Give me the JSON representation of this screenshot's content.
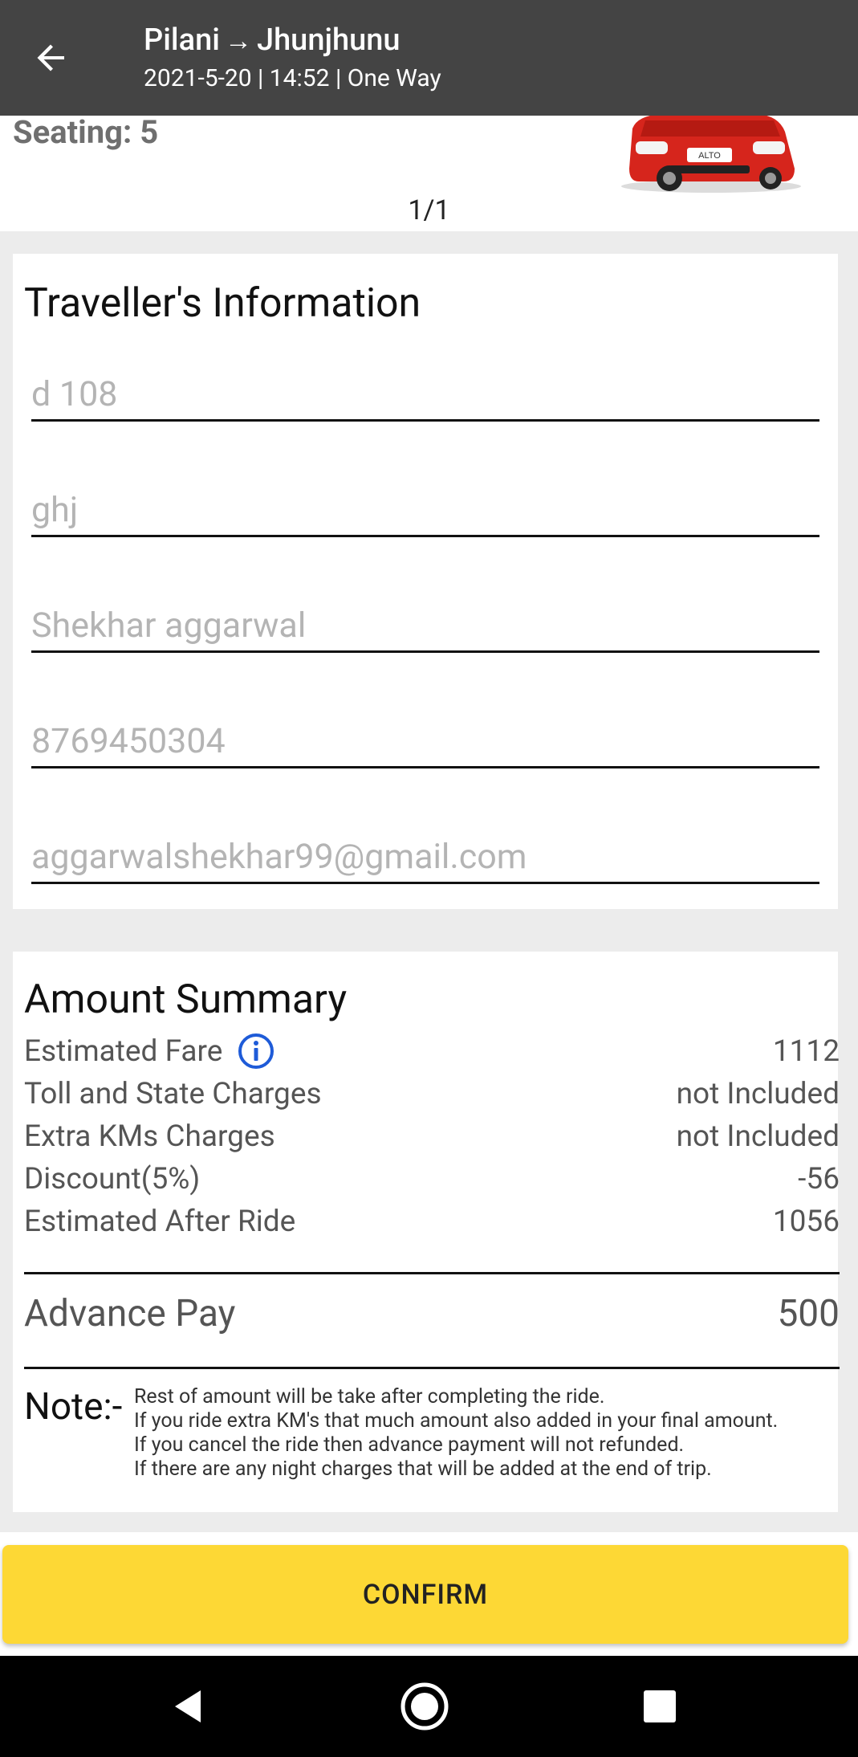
{
  "header": {
    "from": "Pilani",
    "arrow": "→",
    "to": "Jhunjhunu",
    "subtitle": "2021-5-20 | 14:52 | One Way",
    "back_icon": "arrow-left-icon"
  },
  "car": {
    "seating": "Seating: 5",
    "image": "red-hatchback-car",
    "pager": "1/1"
  },
  "traveller": {
    "title": "Traveller's Information",
    "fields": [
      {
        "name": "address",
        "placeholder": "d 108"
      },
      {
        "name": "locality",
        "placeholder": "ghj"
      },
      {
        "name": "full-name",
        "placeholder": "Shekhar aggarwal"
      },
      {
        "name": "phone",
        "placeholder": "8769450304"
      },
      {
        "name": "email",
        "placeholder": "aggarwalshekhar99@gmail.com"
      }
    ]
  },
  "summary": {
    "title": "Amount Summary",
    "rows": [
      {
        "label": "Estimated Fare",
        "value": "1112"
      },
      {
        "label": "Toll and State Charges",
        "value": "not Included"
      },
      {
        "label": "Extra KMs Charges",
        "value": "not Included"
      },
      {
        "label": "Discount(5%)",
        "value": "-56"
      },
      {
        "label": "Estimated After Ride",
        "value": "1056"
      }
    ],
    "advance": {
      "label": "Advance Pay",
      "value": "500"
    },
    "note_label": "Note:-",
    "note_lines": [
      "Rest of amount will be take after completing the ride.",
      "If you ride extra KM's that much amount also added in your final amount.",
      "If you cancel the ride then advance payment will not refunded.",
      "If there are any night charges that will be added at the end of trip."
    ],
    "info_icon": "info-circle-icon"
  },
  "confirm_label": "CONFIRM",
  "colors": {
    "appbar": "#444444",
    "accent": "#fdd835",
    "info_blue": "#1e5bd8"
  }
}
